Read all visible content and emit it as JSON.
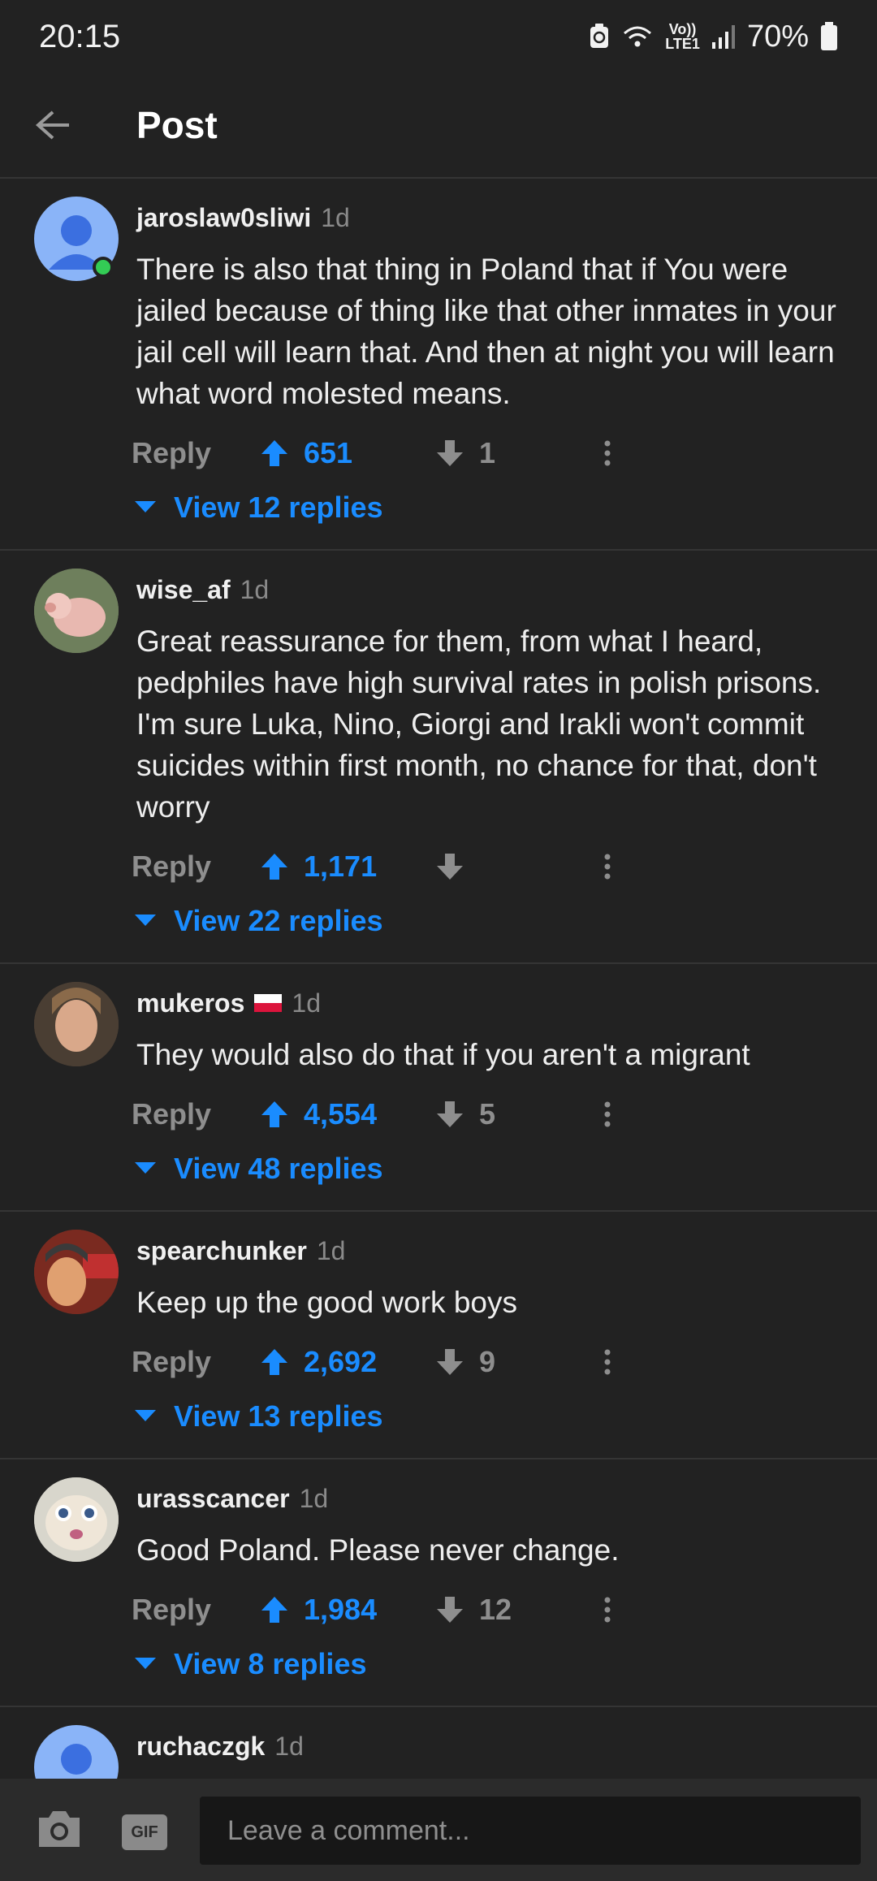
{
  "status": {
    "time": "20:15",
    "battery": "70%",
    "volte": "Vo))",
    "lte": "LTE1"
  },
  "header": {
    "title": "Post"
  },
  "comments": [
    {
      "user": "jaroslaw0sliwi",
      "age": "1d",
      "body": "There is also that thing in Poland that if You were jailed because of thing like that other inmates in your jail cell will learn that. And then at night you will learn what word molested means.",
      "reply": "Reply",
      "upvotes": "651",
      "downvotes": "1",
      "view_replies": "View 12 replies"
    },
    {
      "user": "wise_af",
      "age": "1d",
      "body": "Great reassurance for them, from what I heard, pedphiles have high survival rates in polish prisons. I'm sure Luka, Nino, Giorgi and Irakli won't commit suicides within first month, no chance for that, don't worry",
      "reply": "Reply",
      "upvotes": "1,171",
      "downvotes": "",
      "view_replies": "View 22 replies"
    },
    {
      "user": "mukeros",
      "age": "1d",
      "body": "They would also do that if you aren't a migrant",
      "reply": "Reply",
      "upvotes": "4,554",
      "downvotes": "5",
      "view_replies": "View 48 replies"
    },
    {
      "user": "spearchunker",
      "age": "1d",
      "body": "Keep up the good work boys",
      "reply": "Reply",
      "upvotes": "2,692",
      "downvotes": "9",
      "view_replies": "View 13 replies"
    },
    {
      "user": "urasscancer",
      "age": "1d",
      "body": "Good Poland. Please never change.",
      "reply": "Reply",
      "upvotes": "1,984",
      "downvotes": "12",
      "view_replies": "View 8 replies"
    },
    {
      "user": "ruchaczgk",
      "age": "1d"
    }
  ],
  "composer": {
    "placeholder": "Leave a comment...",
    "gif_label": "GIF"
  },
  "colors": {
    "accent": "#1a8cff",
    "background": "#222222",
    "muted": "#8e8e8e",
    "online": "#33cc55"
  }
}
